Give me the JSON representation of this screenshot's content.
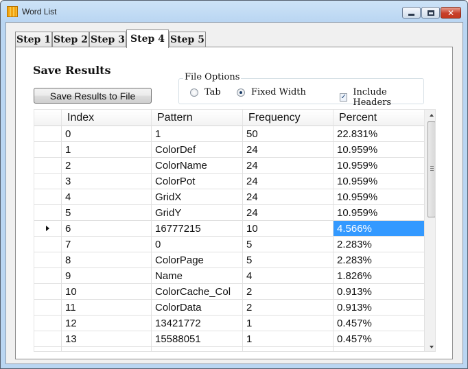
{
  "window": {
    "title": "Word List",
    "minimize_label": "–",
    "maximize_label": "☐",
    "close_label": "✕"
  },
  "tabs": [
    {
      "label": "Step 1",
      "active": false
    },
    {
      "label": "Step 2",
      "active": false
    },
    {
      "label": "Step 3",
      "active": false
    },
    {
      "label": "Step 4",
      "active": true
    },
    {
      "label": "Step 5",
      "active": false
    }
  ],
  "page": {
    "section_title": "Save Results",
    "save_button_label": "Save Results to File"
  },
  "file_options": {
    "legend": "File Options",
    "tab_label": "Tab",
    "tab_selected": false,
    "fixed_width_label": "Fixed Width",
    "fixed_width_selected": true,
    "include_headers_label": "Include Headers",
    "include_headers_checked": true,
    "check_glyph": "✓"
  },
  "grid": {
    "columns": [
      "Index",
      "Pattern",
      "Frequency",
      "Percent"
    ],
    "current_row_marker": "row-arrow-icon",
    "selected_color": "#3399ff",
    "rows": [
      {
        "index": "0",
        "pattern": "1",
        "frequency": "50",
        "percent": "22.831%"
      },
      {
        "index": "1",
        "pattern": "ColorDef",
        "frequency": "24",
        "percent": "10.959%"
      },
      {
        "index": "2",
        "pattern": "ColorName",
        "frequency": "24",
        "percent": "10.959%"
      },
      {
        "index": "3",
        "pattern": "ColorPot",
        "frequency": "24",
        "percent": "10.959%"
      },
      {
        "index": "4",
        "pattern": "GridX",
        "frequency": "24",
        "percent": "10.959%"
      },
      {
        "index": "5",
        "pattern": "GridY",
        "frequency": "24",
        "percent": "10.959%"
      },
      {
        "index": "6",
        "pattern": "16777215",
        "frequency": "10",
        "percent": "4.566%",
        "current": true,
        "selected_cell": "percent"
      },
      {
        "index": "7",
        "pattern": "0",
        "frequency": "5",
        "percent": "2.283%"
      },
      {
        "index": "8",
        "pattern": "ColorPage",
        "frequency": "5",
        "percent": "2.283%"
      },
      {
        "index": "9",
        "pattern": "Name",
        "frequency": "4",
        "percent": "1.826%"
      },
      {
        "index": "10",
        "pattern": "ColorCache_Col",
        "frequency": "2",
        "percent": "0.913%"
      },
      {
        "index": "11",
        "pattern": "ColorData",
        "frequency": "2",
        "percent": "0.913%"
      },
      {
        "index": "12",
        "pattern": "13421772",
        "frequency": "1",
        "percent": "0.457%"
      },
      {
        "index": "13",
        "pattern": "15588051",
        "frequency": "1",
        "percent": "0.457%"
      }
    ]
  }
}
